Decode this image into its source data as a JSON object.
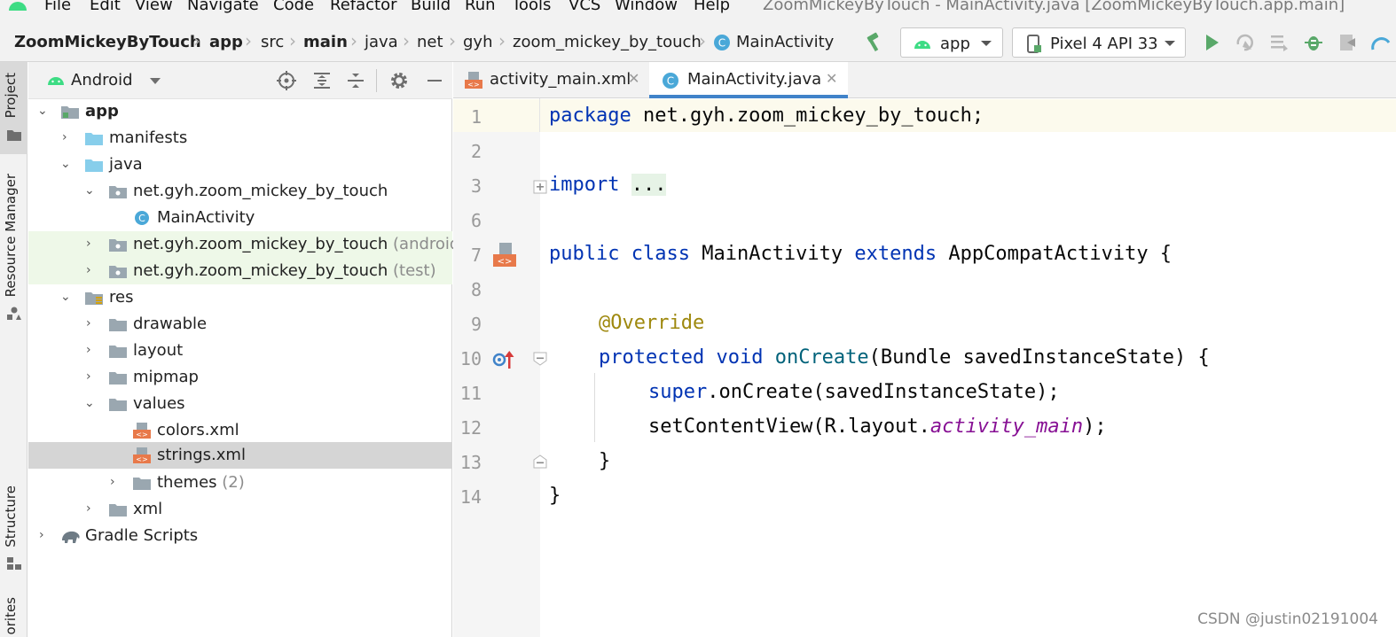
{
  "menubar": {
    "items": [
      "File",
      "Edit",
      "View",
      "Navigate",
      "Code",
      "Refactor",
      "Build",
      "Run",
      "Tools",
      "VCS",
      "Window",
      "Help"
    ],
    "window_title": "ZoomMickeyByTouch - MainActivity.java [ZoomMickeyByTouch.app.main]"
  },
  "breadcrumb": [
    "ZoomMickeyByTouch",
    "app",
    "src",
    "main",
    "java",
    "net",
    "gyh",
    "zoom_mickey_by_touch",
    "MainActivity"
  ],
  "toolbar": {
    "run_config": "app",
    "device": "Pixel 4 API 33"
  },
  "tool_stripe": {
    "project": "Project",
    "resource_manager": "Resource Manager",
    "structure": "Structure",
    "favorites": "orites"
  },
  "project_panel": {
    "view_mode": "Android",
    "tree": [
      {
        "label": "app",
        "suffix": ""
      },
      {
        "label": "manifests",
        "suffix": ""
      },
      {
        "label": "java",
        "suffix": ""
      },
      {
        "label": "net.gyh.zoom_mickey_by_touch",
        "suffix": ""
      },
      {
        "label": "MainActivity",
        "suffix": ""
      },
      {
        "label": "net.gyh.zoom_mickey_by_touch",
        "suffix": "(androidT"
      },
      {
        "label": "net.gyh.zoom_mickey_by_touch",
        "suffix": "(test)"
      },
      {
        "label": "res",
        "suffix": ""
      },
      {
        "label": "drawable",
        "suffix": ""
      },
      {
        "label": "layout",
        "suffix": ""
      },
      {
        "label": "mipmap",
        "suffix": ""
      },
      {
        "label": "values",
        "suffix": ""
      },
      {
        "label": "colors.xml",
        "suffix": ""
      },
      {
        "label": "strings.xml",
        "suffix": ""
      },
      {
        "label": "themes",
        "suffix": "(2)"
      },
      {
        "label": "xml",
        "suffix": ""
      },
      {
        "label": "Gradle Scripts",
        "suffix": ""
      }
    ]
  },
  "editor": {
    "tabs": [
      {
        "label": "activity_main.xml",
        "active": false
      },
      {
        "label": "MainActivity.java",
        "active": true
      }
    ],
    "line_numbers": [
      "1",
      "2",
      "3",
      "6",
      "7",
      "8",
      "9",
      "10",
      "11",
      "12",
      "13",
      "14"
    ],
    "code": {
      "l1_kw": "package",
      "l1_rest": " net.gyh.zoom_mickey_by_touch;",
      "l3_kw": "import",
      "l3_fold": "...",
      "l7_kw1": "public",
      "l7_kw2": "class",
      "l7_name": "MainActivity",
      "l7_kw3": "extends",
      "l7_rest": "AppCompatActivity {",
      "l9_ann": "@Override",
      "l10_kw1": "protected",
      "l10_kw2": "void",
      "l10_fn": "onCreate",
      "l10_rest": "(Bundle savedInstanceState) {",
      "l11_kw": "super",
      "l11_rest": ".onCreate(savedInstanceState);",
      "l12_pre": "setContentView(R.layout.",
      "l12_it": "activity_main",
      "l12_post": ");",
      "l13": "}",
      "l14": "}"
    }
  },
  "watermark": "CSDN @justin02191004"
}
